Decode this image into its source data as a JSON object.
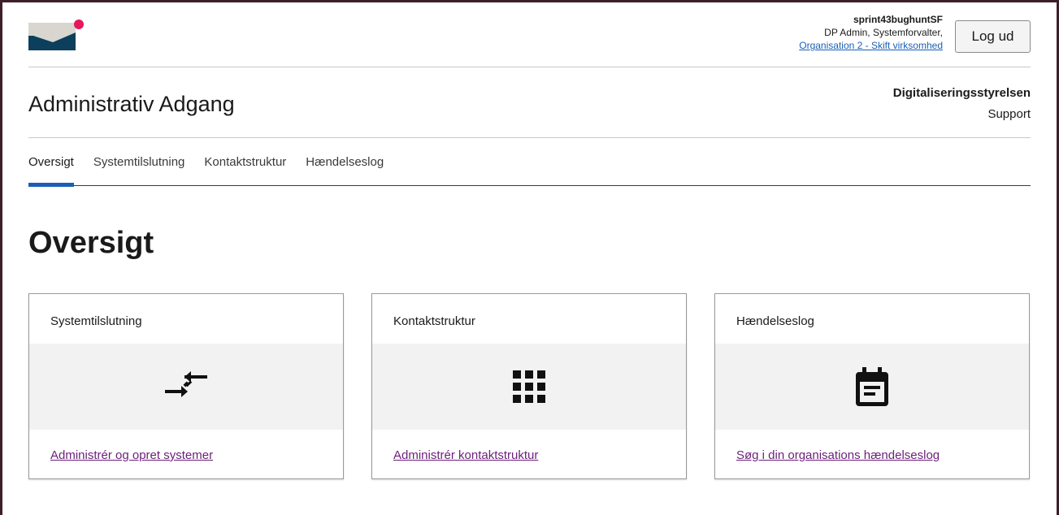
{
  "header": {
    "user_name": "sprint43bughuntSF",
    "user_role": "DP Admin, Systemforvalter,",
    "org_link": "Organisation 2 - Skift virksomhed",
    "logout_label": "Log ud"
  },
  "titlebar": {
    "app_title": "Administrativ Adgang",
    "agency": "Digitaliseringsstyrelsen",
    "support": "Support"
  },
  "tabs": [
    {
      "label": "Oversigt",
      "active": true
    },
    {
      "label": "Systemtilslutning",
      "active": false
    },
    {
      "label": "Kontaktstruktur",
      "active": false
    },
    {
      "label": "Hændelseslog",
      "active": false
    }
  ],
  "page": {
    "heading": "Oversigt"
  },
  "cards": [
    {
      "title": "Systemtilslutning",
      "icon": "arrows-icon",
      "link": "Administrér og opret systemer"
    },
    {
      "title": "Kontaktstruktur",
      "icon": "grid-icon",
      "link": "Administrér kontaktstruktur"
    },
    {
      "title": "Hændelseslog",
      "icon": "calendar-icon",
      "link": "Søg i din organisations hændelseslog"
    }
  ],
  "colors": {
    "accent": "#1a5fb4",
    "link_visited": "#6b1f7a",
    "logo_dark": "#0b3f5c",
    "logo_light": "#d8d6cf",
    "logo_dot": "#e4185a",
    "frame": "#3d1f2a"
  }
}
